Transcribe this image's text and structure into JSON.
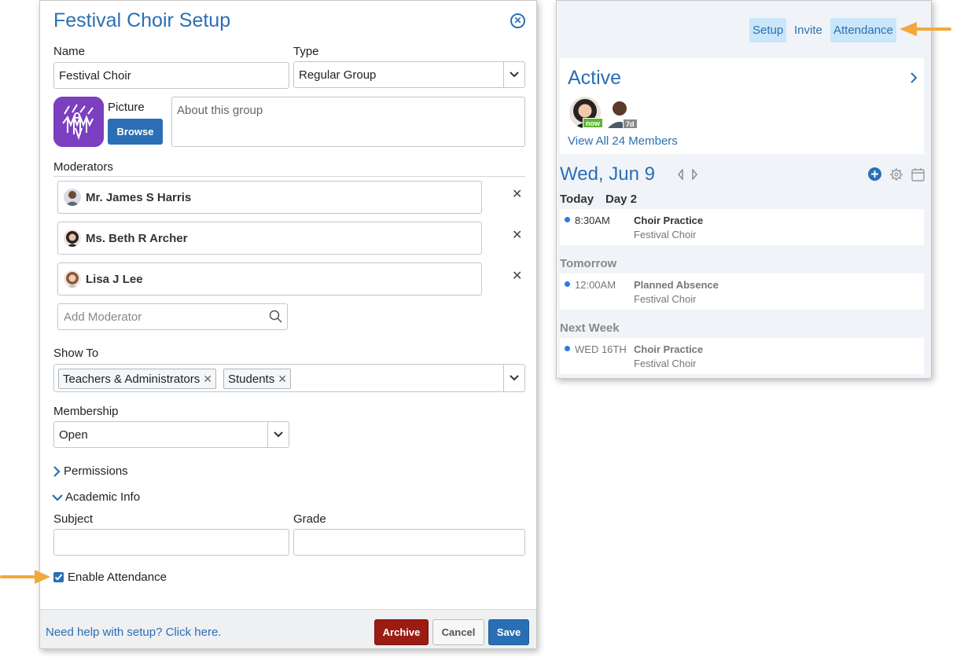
{
  "setup": {
    "title": "Festival Choir Setup",
    "name_label": "Name",
    "name_value": "Festival Choir",
    "type_label": "Type",
    "type_value": "Regular Group",
    "picture_label": "Picture",
    "browse_label": "Browse",
    "about_placeholder": "About this group",
    "moderators_label": "Moderators",
    "moderators": [
      {
        "name": "Mr. James S Harris"
      },
      {
        "name": "Ms. Beth R Archer"
      },
      {
        "name": "Lisa J Lee"
      }
    ],
    "add_moderator_placeholder": "Add Moderator",
    "show_to_label": "Show To",
    "show_to_tags": [
      "Teachers & Administrators",
      "Students"
    ],
    "membership_label": "Membership",
    "membership_value": "Open",
    "permissions_label": "Permissions",
    "academic_info_label": "Academic Info",
    "subject_label": "Subject",
    "grade_label": "Grade",
    "enable_attendance_label": "Enable Attendance",
    "enable_attendance_checked": true,
    "help_link": "Need help with setup? Click here.",
    "archive_label": "Archive",
    "cancel_label": "Cancel",
    "save_label": "Save"
  },
  "panel": {
    "nav": [
      "Setup",
      "Invite",
      "Attendance"
    ],
    "active_title": "Active",
    "badges": [
      "now",
      "7d"
    ],
    "view_all": "View All 24 Members",
    "date_title": "Wed, Jun 9",
    "today_label": "Today",
    "day_label": "Day 2",
    "sections": [
      {
        "label": "",
        "events": [
          {
            "time": "8:30AM",
            "title": "Choir Practice",
            "group": "Festival Choir"
          }
        ]
      },
      {
        "label": "Tomorrow",
        "events": [
          {
            "time": "12:00AM",
            "title": "Planned Absence",
            "group": "Festival Choir"
          }
        ]
      },
      {
        "label": "Next Week",
        "events": [
          {
            "time": "WED 16TH",
            "title": "Choir Practice",
            "group": "Festival Choir"
          }
        ]
      }
    ]
  },
  "colors": {
    "accent": "#2a6fb5",
    "archive": "#9b1c12",
    "highlight": "#c9e6fa",
    "arrow": "#f2a93b",
    "badge_now": "#5cb82e",
    "badge_7d": "#8a8a8a"
  }
}
